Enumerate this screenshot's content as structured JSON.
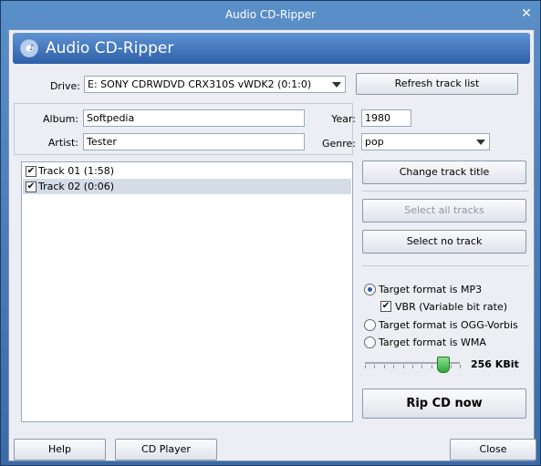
{
  "window": {
    "title": "Audio CD-Ripper",
    "close_glyph": "✕"
  },
  "banner": {
    "title": "Audio CD-Ripper",
    "icon": "cd-music-icon"
  },
  "drive": {
    "label": "Drive:",
    "value": "E: SONY CDRWDVD CRX310S vWDK2 (0:1:0)"
  },
  "refresh_button": "Refresh track list",
  "album": {
    "label": "Album:",
    "value": "Softpedia"
  },
  "artist": {
    "label": "Artist:",
    "value": "Tester"
  },
  "year": {
    "label": "Year:",
    "value": "1980"
  },
  "genre": {
    "label": "Genre:",
    "value": "pop"
  },
  "tracks": [
    {
      "title": "Track 01 (1:58)",
      "checked": true,
      "selected": false
    },
    {
      "title": "Track 02 (0:06)",
      "checked": true,
      "selected": true
    }
  ],
  "actions": {
    "change_title": "Change track title",
    "select_all": "Select all tracks",
    "select_none": "Select no track",
    "rip": "Rip CD now"
  },
  "formats": {
    "mp3": {
      "label": "Target format is MP3",
      "selected": true
    },
    "vbr": {
      "label": "VBR (Variable bit rate)",
      "checked": true
    },
    "ogg": {
      "label": "Target format is OGG-Vorbis",
      "selected": false
    },
    "wma": {
      "label": "Target format is WMA",
      "selected": false
    }
  },
  "bitrate": {
    "label": "256 KBit",
    "level_fraction": 0.82
  },
  "footer": {
    "help": "Help",
    "cd_player": "CD Player",
    "close": "Close"
  },
  "colors": {
    "title_bar": "#3b6aa6",
    "banner": "#2d5fa8",
    "selection": "#d4dce8",
    "slider_thumb": "#2fa83a"
  }
}
